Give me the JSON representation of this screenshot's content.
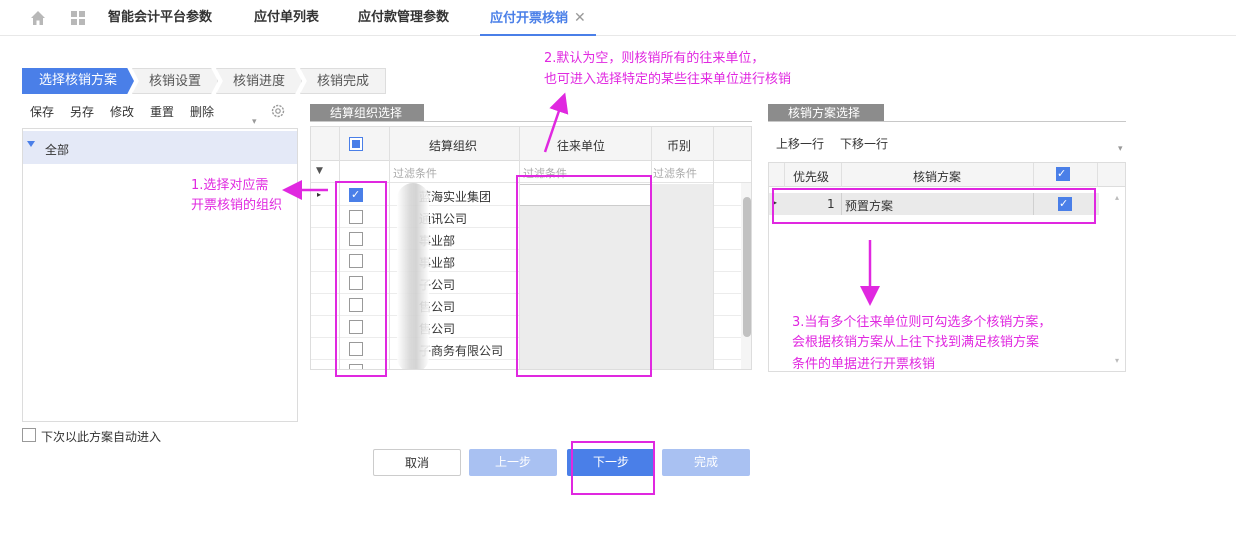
{
  "tabs": [
    {
      "label": "智能会计平台参数"
    },
    {
      "label": "应付单列表"
    },
    {
      "label": "应付款管理参数"
    },
    {
      "label": "应付开票核销",
      "active": true
    }
  ],
  "wizard": {
    "steps": [
      "选择核销方案",
      "核销设置",
      "核销进度",
      "核销完成"
    ]
  },
  "left_toolbar": {
    "save": "保存",
    "save_as": "另存",
    "modify": "修改",
    "reset": "重置",
    "delete": "删除"
  },
  "tree": {
    "root_label": "全部"
  },
  "auto_enter_label": "下次以此方案自动进入",
  "org_section": {
    "title": "结算组织选择",
    "columns": [
      "结算组织",
      "往来单位",
      "币别"
    ],
    "filter_placeholder": "过滤条件",
    "rows": [
      {
        "name": "蓝海实业集团",
        "checked": true
      },
      {
        "name": "通讯公司",
        "checked": false
      },
      {
        "name": "事业部",
        "checked": false
      },
      {
        "name": "事业部",
        "checked": false
      },
      {
        "name": "子公司",
        "checked": false
      },
      {
        "name": "售公司",
        "checked": false
      },
      {
        "name": "售公司",
        "checked": false
      },
      {
        "name": "子商务有限公司",
        "checked": false
      },
      {
        "name": "",
        "checked": false
      }
    ]
  },
  "scheme_section": {
    "title": "核销方案选择",
    "move_up": "上移一行",
    "move_down": "下移一行",
    "columns": [
      "优先级",
      "核销方案"
    ],
    "rows": [
      {
        "priority": "1",
        "scheme": "预置方案",
        "checked": true
      }
    ]
  },
  "buttons": {
    "cancel": "取消",
    "prev": "上一步",
    "next": "下一步",
    "finish": "完成"
  },
  "annotations": {
    "note1_line1": "1.选择对应需",
    "note1_line2": "开票核销的组织",
    "note2_line1": "2.默认为空，则核销所有的往来单位，",
    "note2_line2": "也可进入选择特定的某些往来单位进行核销",
    "note3_line1": "3.当有多个往来单位则可勾选多个核销方案，",
    "note3_line2": "会根据核销方案从上往下找到满足核销方案",
    "note3_line3": "条件的单据进行开票核销"
  },
  "colors": {
    "accent": "#4a7fe8",
    "annotation": "#e028e0"
  }
}
